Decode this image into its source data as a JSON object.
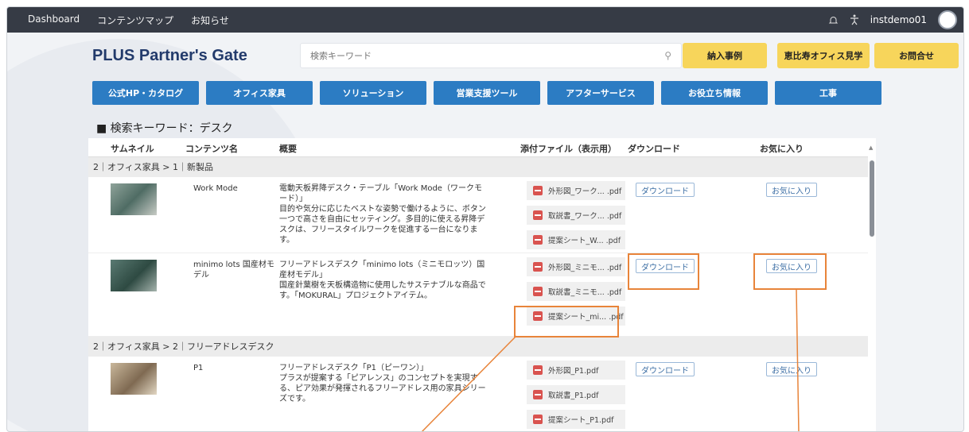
{
  "topbar": {
    "nav": [
      "Dashboard",
      "コンテンツマップ",
      "お知らせ"
    ],
    "username": "instdemo01"
  },
  "header": {
    "logo": "PLUS Partner's Gate",
    "search_placeholder": "検索キーワード",
    "buttons": [
      "納入事例",
      "恵比寿オフィス見学",
      "お問合せ"
    ]
  },
  "categories": [
    "公式HP・カタログ",
    "オフィス家具",
    "ソリューション",
    "営業支援ツール",
    "アフターサービス",
    "お役立ち情報",
    "工事"
  ],
  "heading": "■ 検索キーワード：デスク",
  "table": {
    "columns": [
      "サムネイル",
      "コンテンツ名",
      "概要",
      "添付ファイル（表示用）",
      "ダウンロード",
      "お気に入り"
    ],
    "groups": [
      "2｜オフィス家具 > 1｜新製品",
      "2｜オフィス家具 > 2｜フリーアドレスデスク"
    ],
    "rows": [
      {
        "name": "Work Mode",
        "desc": "電動天板昇降デスク・テーブル「Work Mode（ワークモード）」\n目的や気分に応じたベストな姿勢で働けるように、ボタン一つで高さを自由にセッティング。多目的に使える昇降デスクは、フリースタイルワークを促進する一台になります。",
        "files": [
          "外形図_ワーク... .pdf",
          "取説書_ワーク... .pdf",
          "提案シート_W... .pdf"
        ]
      },
      {
        "name": "minimo lots 国産材モデル",
        "desc": "フリーアドレスデスク「minimo lots（ミニモロッツ）国産材モデル」\n国産針葉樹を天板構造物に使用したサステナブルな商品です。「MOKURAL」プロジェクトアイテム。",
        "files": [
          "外形図_ミニモ... .pdf",
          "取説書_ミニモ... .pdf",
          "提案シート_mi... .pdf"
        ]
      },
      {
        "name": "P1",
        "desc": "フリーアドレスデスク「P1（ピーワン）」\nプラスが提案する「ピアレンス」のコンセプトを実現する、ピア効果が発揮されるフリーアドレス用の家具シリーズです。",
        "files": [
          "外形図_P1.pdf",
          "取説書_P1.pdf",
          "提案シート_P1.pdf"
        ]
      }
    ],
    "download_label": "ダウンロード",
    "favorite_label": "お気に入り"
  },
  "colors": {
    "topbar": "#363b45",
    "category": "#2c7cc3",
    "yellow": "#f7d55b",
    "highlight": "#e8843a",
    "logo": "#223a6b"
  }
}
